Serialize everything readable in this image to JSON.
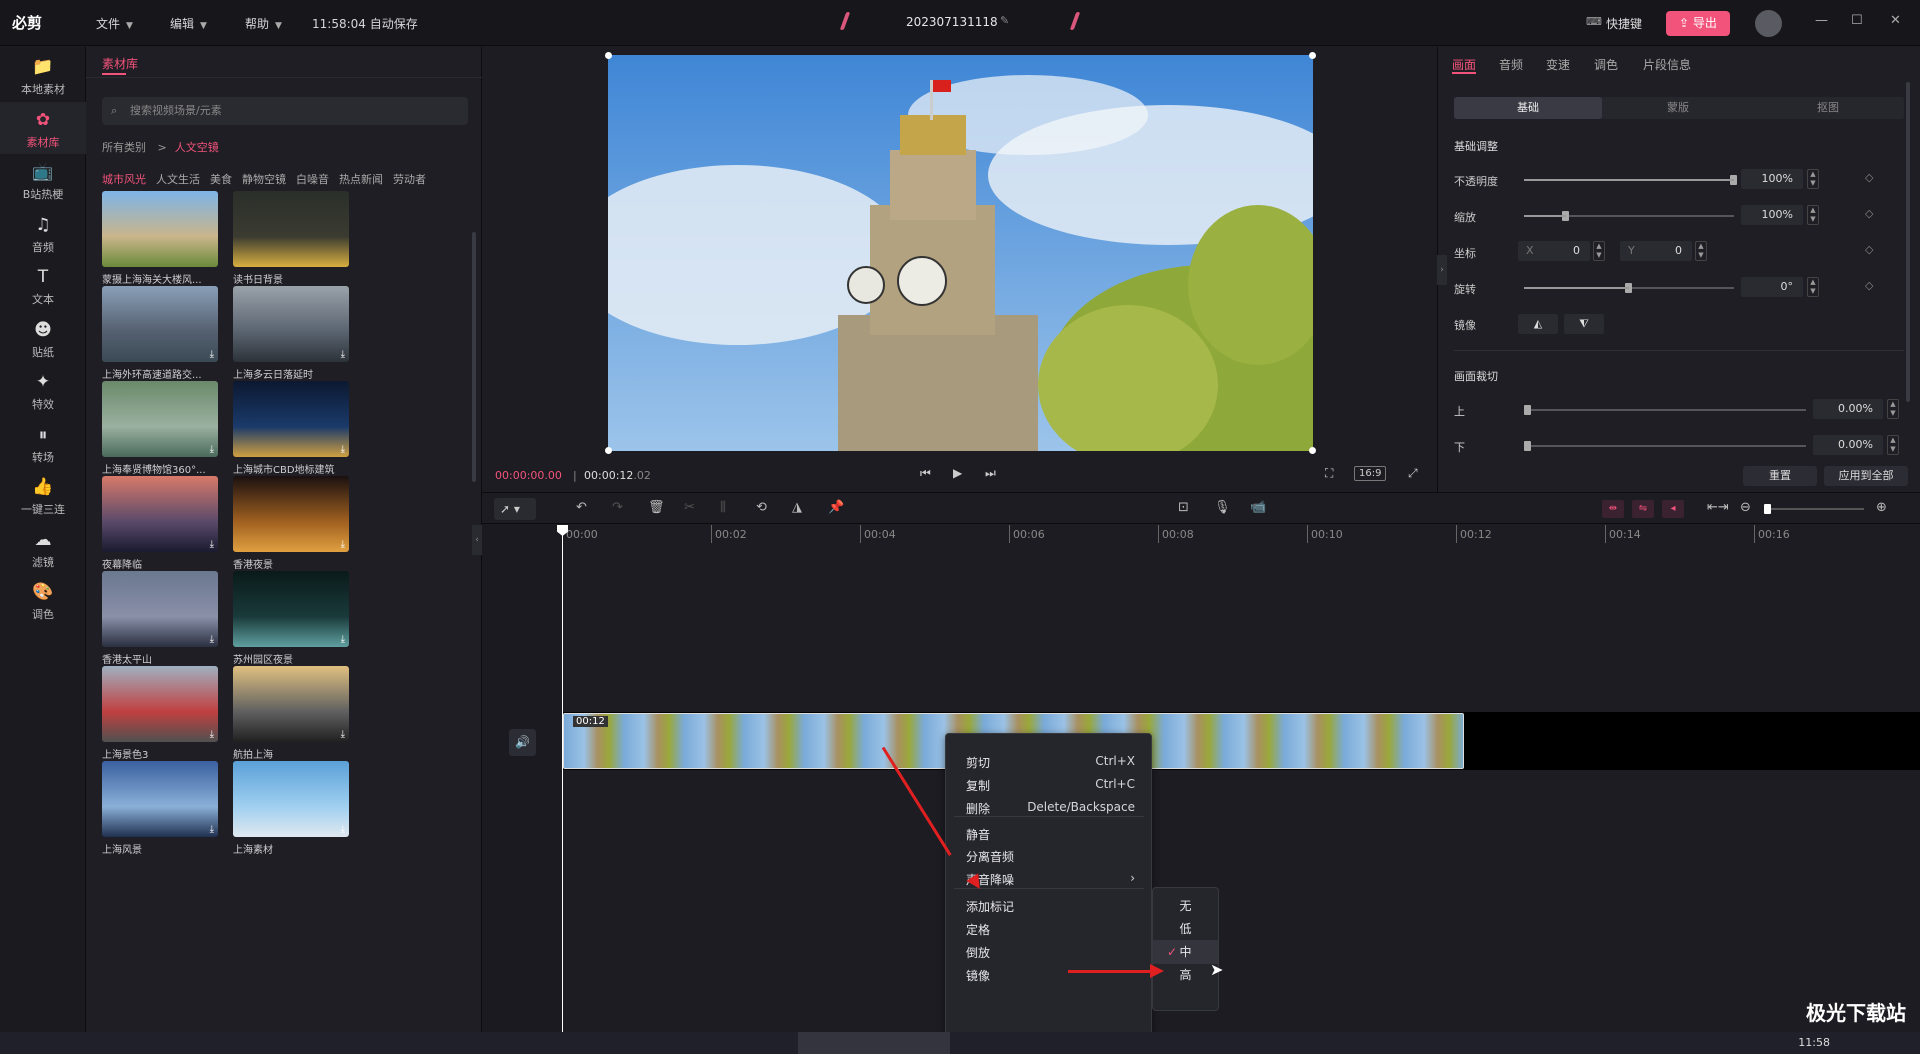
{
  "app": {
    "logo": "必剪",
    "menus": [
      "文件",
      "编辑",
      "帮助"
    ],
    "autosave": "11:58:04 自动保存",
    "project": "202307131118",
    "hotkey": "快捷键",
    "export": "导出",
    "wctl": [
      "—",
      "☐",
      "✕"
    ]
  },
  "nav": [
    {
      "label": "本地素材",
      "icon": "folder-icon"
    },
    {
      "label": "素材库",
      "icon": "library-icon",
      "active": true
    },
    {
      "label": "B站热梗",
      "icon": "bilibili-icon"
    },
    {
      "label": "音频",
      "icon": "music-icon"
    },
    {
      "label": "文本",
      "icon": "text-icon"
    },
    {
      "label": "贴纸",
      "icon": "sticker-icon"
    },
    {
      "label": "特效",
      "icon": "effect-icon"
    },
    {
      "label": "转场",
      "icon": "transition-icon"
    },
    {
      "label": "一键三连",
      "icon": "like-icon"
    },
    {
      "label": "滤镜",
      "icon": "filter-icon"
    },
    {
      "label": "调色",
      "icon": "palette-icon"
    }
  ],
  "library": {
    "tab": "素材库",
    "search_placeholder": "搜索视频场景/元素",
    "crumb_root": "所有类别",
    "crumb_sep": ">",
    "crumb_current": "人文空镜",
    "categories": [
      "城市风光",
      "人文生活",
      "美食",
      "静物空镜",
      "白噪音",
      "热点新闻",
      "劳动者"
    ],
    "items": [
      {
        "label": "蒙摄上海海关大楼风...",
        "colors": [
          "#7eb4e8",
          "#c9b58a",
          "#6a8a3a"
        ]
      },
      {
        "label": "读书日背景",
        "colors": [
          "#2a2f2a",
          "#3b3b30",
          "#d8b040"
        ]
      },
      {
        "label": "上海外环高速道路交...",
        "colors": [
          "#8aa0b8",
          "#556070",
          "#3a4a55"
        ]
      },
      {
        "label": "上海多云日落延时",
        "colors": [
          "#9aa2aa",
          "#5a6470",
          "#2c3238"
        ]
      },
      {
        "label": "上海奉贤博物馆360°...",
        "colors": [
          "#6a8a6a",
          "#9ab0a0",
          "#4a6a5a"
        ]
      },
      {
        "label": "上海城市CBD地标建筑",
        "colors": [
          "#0c1830",
          "#1a3a6a",
          "#d0a040"
        ]
      },
      {
        "label": "夜幕降临",
        "colors": [
          "#d87a6a",
          "#5a4a6a",
          "#1a1a30"
        ]
      },
      {
        "label": "香港夜景",
        "colors": [
          "#1a1010",
          "#a06020",
          "#e0a040"
        ]
      },
      {
        "label": "香港太平山",
        "colors": [
          "#6a7890",
          "#8a90a8",
          "#2a3040"
        ]
      },
      {
        "label": "苏州园区夜景",
        "colors": [
          "#0a1a1a",
          "#1a3a3a",
          "#60a0a0"
        ]
      },
      {
        "label": "上海景色3",
        "colors": [
          "#a0b0c0",
          "#c04040",
          "#505050"
        ]
      },
      {
        "label": "航拍上海",
        "colors": [
          "#e0c080",
          "#606060",
          "#202020"
        ]
      },
      {
        "label": "上海风景",
        "colors": [
          "#3a60a0",
          "#8ab0d8",
          "#203050"
        ]
      },
      {
        "label": "上海素材",
        "colors": [
          "#5aa0d8",
          "#a0d0f0",
          "#e0e8f0"
        ]
      }
    ]
  },
  "preview": {
    "current": "00:00:00.00",
    "sep": "|",
    "total_main": "00:00:12",
    "total_frac": ".02",
    "ratio": "16:9"
  },
  "props": {
    "tabs": [
      "画面",
      "音频",
      "变速",
      "调色",
      "片段信息"
    ],
    "seg": [
      "基础",
      "蒙版",
      "抠图"
    ],
    "section1": "基础调整",
    "opacity": {
      "label": "不透明度",
      "value": "100%",
      "level": 1.0
    },
    "scale": {
      "label": "缩放",
      "value": "100%",
      "level": 0.2
    },
    "pos": {
      "label": "坐标",
      "x_label": "X",
      "x": "0",
      "y_label": "Y",
      "y": "0"
    },
    "rotate": {
      "label": "旋转",
      "value": "0°",
      "level": 0.5
    },
    "mirror": {
      "label": "镜像"
    },
    "section2": "画面裁切",
    "crop_top": {
      "label": "上",
      "value": "0.00%"
    },
    "crop_bottom": {
      "label": "下",
      "value": "0.00%"
    },
    "reset": "重置",
    "apply_all": "应用到全部"
  },
  "timeline": {
    "ticks": [
      "00:00",
      "00:02",
      "00:04",
      "00:06",
      "00:08",
      "00:10",
      "00:12",
      "00:14",
      "00:16"
    ],
    "clip_duration": "00:12"
  },
  "context_menu": {
    "items": [
      {
        "label": "剪切",
        "shortcut": "Ctrl+X"
      },
      {
        "label": "复制",
        "shortcut": "Ctrl+C"
      },
      {
        "label": "删除",
        "shortcut": "Delete/Backspace"
      },
      {
        "label": "静音",
        "shortcut": ""
      },
      {
        "label": "分离音频",
        "shortcut": ""
      },
      {
        "label": "声音降噪",
        "shortcut": "›"
      },
      {
        "label": "添加标记",
        "shortcut": ""
      },
      {
        "label": "定格",
        "shortcut": ""
      },
      {
        "label": "倒放",
        "shortcut": ""
      },
      {
        "label": "镜像",
        "shortcut": ""
      }
    ],
    "submenu": [
      {
        "label": "无"
      },
      {
        "label": "低"
      },
      {
        "label": "中",
        "checked": true
      },
      {
        "label": "高"
      }
    ],
    "check": "✓"
  },
  "taskbar": {
    "clock": "11:58"
  },
  "watermark": "极光下载站"
}
